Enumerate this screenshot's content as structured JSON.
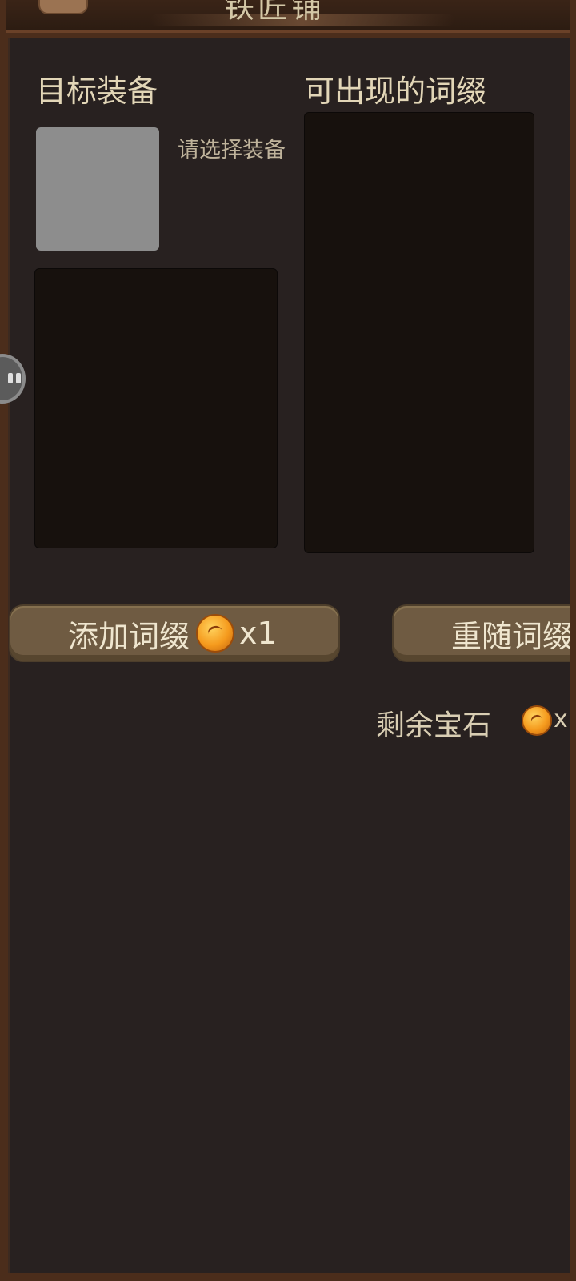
{
  "header": {
    "title": "铁匠铺"
  },
  "left_column": {
    "heading": "目标装备",
    "slot_hint": "请选择装备"
  },
  "right_column": {
    "heading": "可出现的词缀"
  },
  "buttons": {
    "add_affix": {
      "label": "添加词缀",
      "cost": "x1"
    },
    "reroll_affix": {
      "label": "重随词缀"
    }
  },
  "remaining": {
    "label": "剩余宝石",
    "count": "x"
  },
  "colors": {
    "panel_bg": "#282120",
    "frame": "#4b2d1b",
    "button_bg": "#6f5b42",
    "text_light": "#e2d6b7"
  },
  "icons": {
    "gem": "gem-icon",
    "floating_handle": "floating-assistant-icon"
  }
}
